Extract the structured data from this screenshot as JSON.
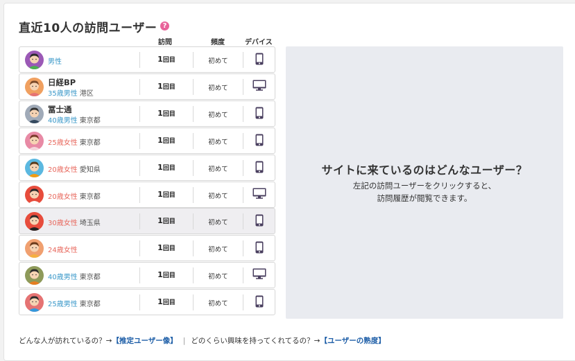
{
  "title": "直近10人の訪問ユーザー",
  "help_icon": "?",
  "columns": {
    "visits": "訪問",
    "frequency": "頻度",
    "device": "デバイス"
  },
  "colors": {
    "male": "#3a98c9",
    "female": "#e8685d",
    "link": "#1f5fa8",
    "help": "#e8639a",
    "device": "#4a3f5f"
  },
  "users": [
    {
      "name": "",
      "demo": "男性",
      "gender": "m",
      "pref": "",
      "visits_num": "1",
      "visits_unit": "回目",
      "freq": "初めて",
      "device": "smartphone-icon",
      "avatar_bg": "#9b59b6",
      "hair": "#2b2b2b",
      "shirt": "#4caf50"
    },
    {
      "name": "日経BP",
      "demo": "35歳男性",
      "gender": "m",
      "pref": "港区",
      "visits_num": "1",
      "visits_unit": "回目",
      "freq": "初めて",
      "device": "monitor-icon",
      "avatar_bg": "#f0a060",
      "hair": "#7a4a2a",
      "shirt": "#e57373"
    },
    {
      "name": "冨士通",
      "demo": "40歳男性",
      "gender": "m",
      "pref": "東京都",
      "visits_num": "1",
      "visits_unit": "回目",
      "freq": "初めて",
      "device": "smartphone-icon",
      "avatar_bg": "#a0aab8",
      "hair": "#333",
      "shirt": "#34495e"
    },
    {
      "name": "",
      "demo": "25歳女性",
      "gender": "f",
      "pref": "東京都",
      "visits_num": "1",
      "visits_unit": "回目",
      "freq": "初めて",
      "device": "smartphone-icon",
      "avatar_bg": "#e88aa5",
      "hair": "#7a3a2a",
      "shirt": "#f5d5dc"
    },
    {
      "name": "",
      "demo": "20歳女性",
      "gender": "f",
      "pref": "愛知県",
      "visits_num": "1",
      "visits_unit": "回目",
      "freq": "初めて",
      "device": "smartphone-icon",
      "avatar_bg": "#5bb8e0",
      "hair": "#5a3a1a",
      "shirt": "#f39c12"
    },
    {
      "name": "",
      "demo": "20歳女性",
      "gender": "f",
      "pref": "東京都",
      "visits_num": "1",
      "visits_unit": "回目",
      "freq": "初めて",
      "device": "monitor-icon",
      "avatar_bg": "#e74c3c",
      "hair": "#2b2b2b",
      "shirt": "#ffffff"
    },
    {
      "name": "",
      "demo": "30歳女性",
      "gender": "f",
      "pref": "埼玉県",
      "visits_num": "1",
      "visits_unit": "回目",
      "freq": "初めて",
      "device": "smartphone-icon",
      "avatar_bg": "#e74c3c",
      "hair": "#2b2b2b",
      "shirt": "#222222",
      "highlight": true
    },
    {
      "name": "",
      "demo": "24歳女性",
      "gender": "f",
      "pref": "",
      "visits_num": "1",
      "visits_unit": "回目",
      "freq": "初めて",
      "device": "smartphone-icon",
      "avatar_bg": "#f0a070",
      "hair": "#6a3a1a",
      "shirt": "#f5b041"
    },
    {
      "name": "",
      "demo": "40歳男性",
      "gender": "m",
      "pref": "東京都",
      "visits_num": "1",
      "visits_unit": "回目",
      "freq": "初めて",
      "device": "monitor-icon",
      "avatar_bg": "#8e9a5a",
      "hair": "#2b2b2b",
      "shirt": "#e67e22"
    },
    {
      "name": "",
      "demo": "25歳男性",
      "gender": "m",
      "pref": "東京都",
      "visits_num": "1",
      "visits_unit": "回目",
      "freq": "初めて",
      "device": "smartphone-icon",
      "avatar_bg": "#e57373",
      "hair": "#2b2b2b",
      "shirt": "#3498db"
    }
  ],
  "panel": {
    "heading": "サイトに来ているのはどんなユーザー？",
    "line1": "左記の訪問ユーザーをクリックすると、",
    "line2": "訪問履歴が閲覧できます。"
  },
  "footer": {
    "q1": "どんな人が訪れているの？→",
    "link1": "【推定ユーザー像】",
    "divider": "|",
    "q2": "どのくらい興味を持ってくれてるの？→",
    "link2": "【ユーザーの熟度】"
  }
}
